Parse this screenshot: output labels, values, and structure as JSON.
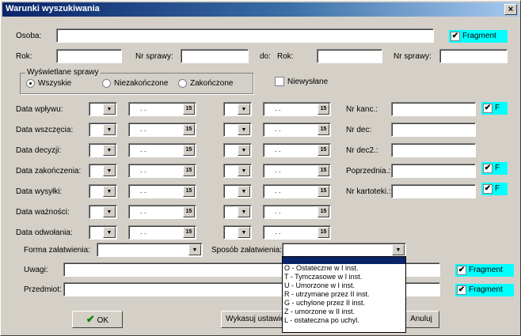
{
  "window": {
    "title": "Warunki wyszukiwania",
    "close": "×"
  },
  "osoba": {
    "label": "Osoba:",
    "fragment": "Fragment"
  },
  "rok1": {
    "label": "Rok:"
  },
  "nrsprawy1": {
    "label": "Nr sprawy:"
  },
  "do": {
    "label": "do:"
  },
  "rok2": {
    "label": "Rok:"
  },
  "nrsprawy2": {
    "label": "Nr sprawy:"
  },
  "group": {
    "title": "Wyświetlane sprawy",
    "opt1": "Wszyskie",
    "opt2": "Niezakończone",
    "opt3": "Zakończone"
  },
  "niewyslane": "Niewysłane",
  "dates": {
    "wplywu": "Data wpływu:",
    "wszczecia": "Data wszczęcia:",
    "decyzji": "Data decyzji:",
    "zakonczenia": "Data zakończenia:",
    "wysylki": "Data wysyłki:",
    "waznosci": "Data ważności:",
    "odwolania": "Data odwołania:"
  },
  "date_placeholder": ". .",
  "cal_icon": "15",
  "right": {
    "nrkanc": "Nr kanc.:",
    "nrdec": "Nr dec:",
    "nrdec2": "Nr dec2.:",
    "poprzednia": "Poprzednia.:",
    "nrkartoteki": "Nr kartoteki.:",
    "f": "F"
  },
  "forma": "Forma załatwienia:",
  "sposob": "Sposób załatwienia:",
  "sposob_options": [
    "O - Ostateczne w I inst.",
    "T - Tymczasowe w I inst.",
    "U - Umorzone w I inst.",
    "R - utrzymane przez II inst.",
    "G - uchylone przez II inst.",
    "Z - umorzone w II inst.",
    "L - ostateczna po uchyl."
  ],
  "uwagi": {
    "label": "Uwagi:",
    "fragment": "Fragment"
  },
  "przedmiot": {
    "label": "Przedmiot:",
    "fragment": "Fragment"
  },
  "buttons": {
    "ok": "OK",
    "reset": "Wykasuj ustawienia",
    "cancel": "Anuluj"
  },
  "check_mark": "✔"
}
